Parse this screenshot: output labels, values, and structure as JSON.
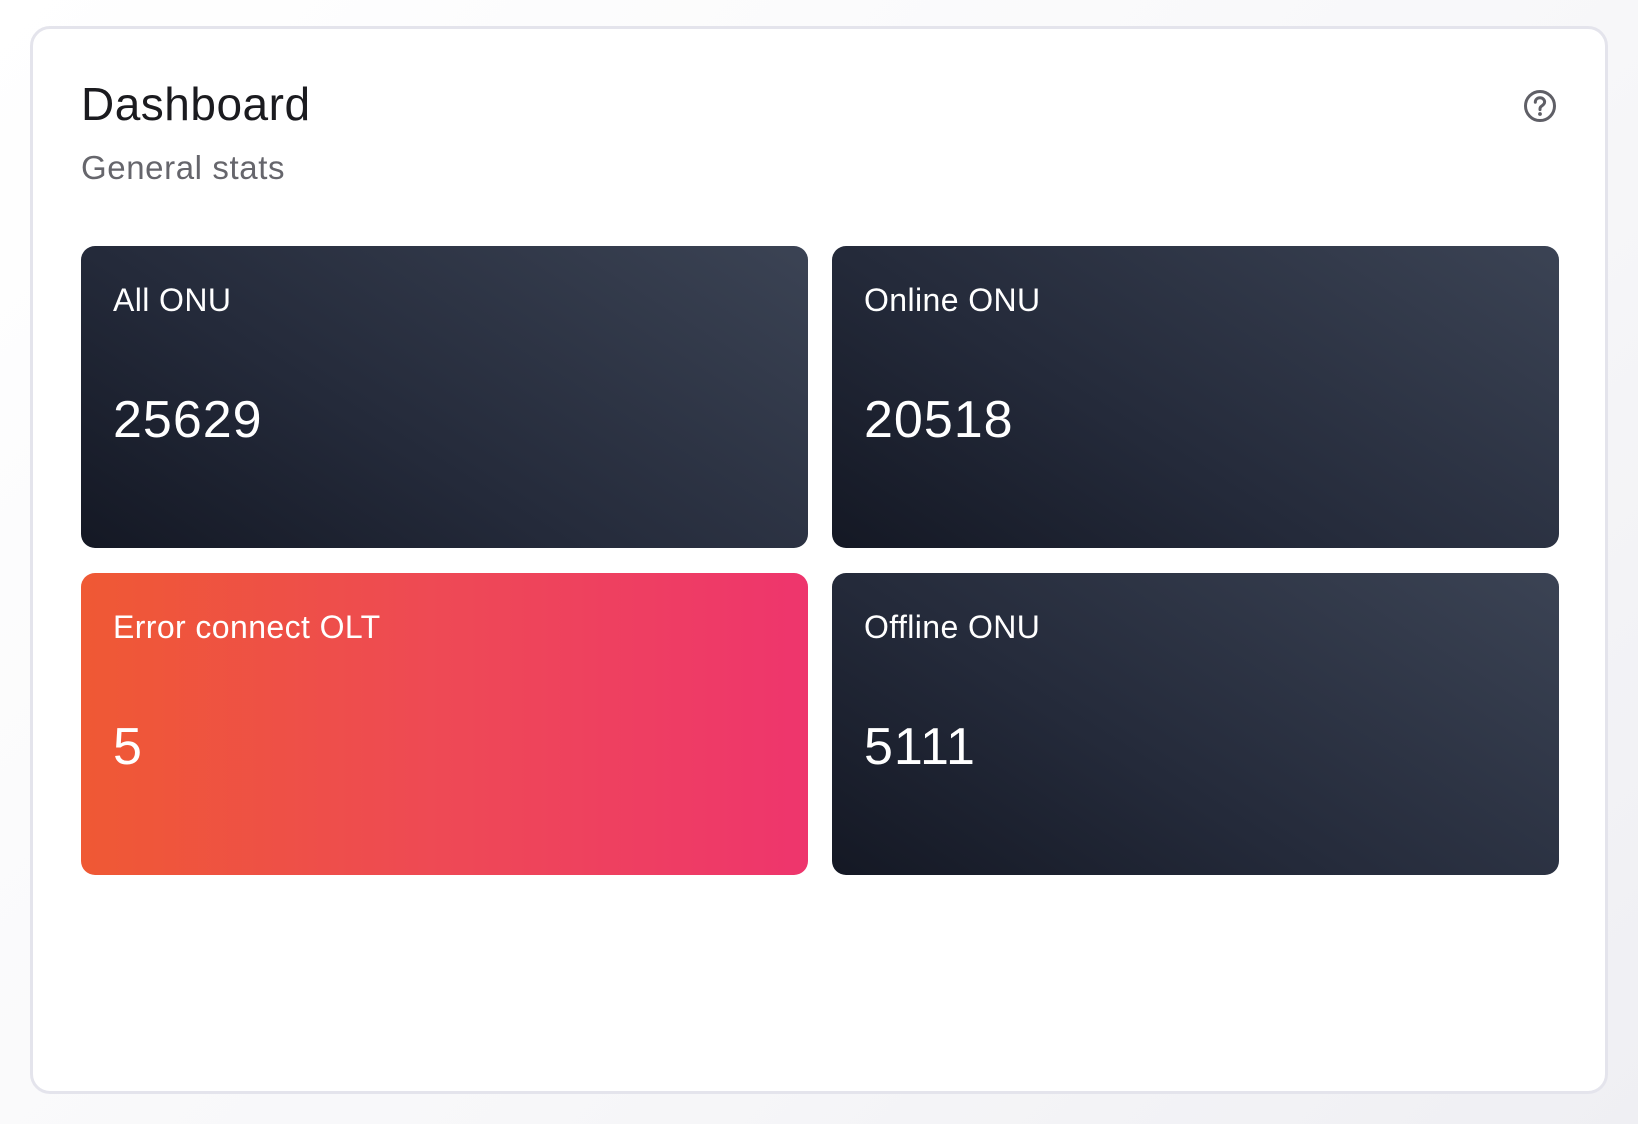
{
  "header": {
    "title": "Dashboard",
    "subtitle": "General stats",
    "help_icon": "question-circle-icon"
  },
  "stats": [
    {
      "label": "All ONU",
      "value": "25629",
      "style": "dark"
    },
    {
      "label": "Online ONU",
      "value": "20518",
      "style": "dark"
    },
    {
      "label": "Error connect OLT",
      "value": "5",
      "style": "alert"
    },
    {
      "label": "Offline ONU",
      "value": "5111",
      "style": "dark"
    }
  ],
  "colors": {
    "dark_start": "#141824",
    "dark_end": "#3b4354",
    "alert_start": "#ef5934",
    "alert_end": "#ee356d",
    "card_border": "#e4e4ec"
  }
}
